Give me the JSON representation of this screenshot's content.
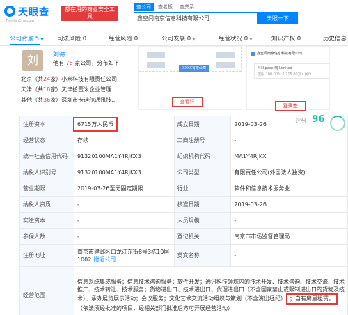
{
  "header": {
    "logo_text": "天眼查",
    "logo_sub": "TianYanCha.com",
    "promo": "都在用的商业安全工具",
    "search_tabs": [
      "查公司",
      "查老板",
      "查关系"
    ],
    "search_value": "鑫空间南京信息科技有限公司",
    "search_button": "天眼一下"
  },
  "tabs": [
    {
      "label": "公司背景",
      "count": "5"
    },
    {
      "label": "司法风险",
      "count": "0"
    },
    {
      "label": "经营风险",
      "count": "0"
    },
    {
      "label": "公司发展",
      "count": "0"
    },
    {
      "label": "经营状况",
      "count": "0"
    },
    {
      "label": "知识产权",
      "count": "0"
    },
    {
      "label": "历史信息",
      "count": ""
    }
  ],
  "owner": {
    "avatar_char": "刘",
    "name": "刘德",
    "stat_prefix": "他有",
    "stat_count": "78",
    "stat_suffix": "家公司，分布如下",
    "relations": [
      {
        "region": "北京",
        "count": "24",
        "desc": "小米科技有限责任公司"
      },
      {
        "region": "天津",
        "count": "18",
        "desc": "天津拾壹米企业管理..."
      },
      {
        "region": "其他",
        "count": "36",
        "desc": "深圳市卡迪尔通讯技..."
      }
    ],
    "graph_center": "XXXX有限公司",
    "graph_button": "查看详",
    "struct_top": "鑫空间南京信息科技有限公司",
    "struct_line1": "MI Space NJ Limited",
    "struct_line2": "控股  100.00%    6,715.00万人民币",
    "struct_button": "登录查"
  },
  "info": {
    "reg_capital_label": "注册资本",
    "reg_capital_value": "6715万人民币",
    "est_date_label": "成立日期",
    "est_date_value": "2019-03-26",
    "score_label": "评分",
    "score_value": "96",
    "status_label": "经营状态",
    "status_value": "存续",
    "biz_reg_label": "工商注册号",
    "biz_reg_value": "-",
    "credit_code_label": "统一社会信用代码",
    "credit_code_value": "91320100MA1Y4RJKX3",
    "org_code_label": "组织机构代码",
    "org_code_value": "MA1Y4RJKX",
    "taxpayer_label": "纳税人识别号",
    "taxpayer_value": "91320100MA1Y4RJKX3",
    "company_type_label": "公司类型",
    "company_type_value": "有限责任公司(外国法人独资)",
    "term_label": "营业期限",
    "term_value": "2019-03-26至无固定期限",
    "industry_label": "行业",
    "industry_value": "软件和信息技术服务业",
    "taxpayer_qual_label": "纳税人资质",
    "taxpayer_qual_value": "-",
    "approval_date_label": "核准日期",
    "approval_date_value": "2019-03-26",
    "paid_capital_label": "实缴资本",
    "paid_capital_value": "-",
    "staff_size_label": "人员规模",
    "staff_size_value": "-",
    "insured_label": "参保人数",
    "insured_value": "-",
    "reg_authority_label": "登记机关",
    "reg_authority_value": "南京市市场监督管理局",
    "address_label": "注册地址",
    "address_value": "南京市建邺区白龙江东街8号3栋10层1002",
    "address_link": "附近公司",
    "english_name_label": "英文名称",
    "english_name_value": "-",
    "scope_label": "经营范围",
    "scope_text_1": "信息系统集成服务；信息技术咨询服务；软件开发；通讯科技领域内的技术开发、技术咨询、技术交流、技术推广、技术转让、技术服务；货物进出口、技术进出口、代理进出口（不含国家禁止或限制进出口的货物及技术）、承办展览展示活动；会议服务；文化艺术交流活动组织与策划（不含演出经纪）",
    "scope_highlight": "；自有房屋租赁。",
    "scope_text_2": "（依法须经批准的项目，经相关部门批准后方可开展经营活动）"
  }
}
